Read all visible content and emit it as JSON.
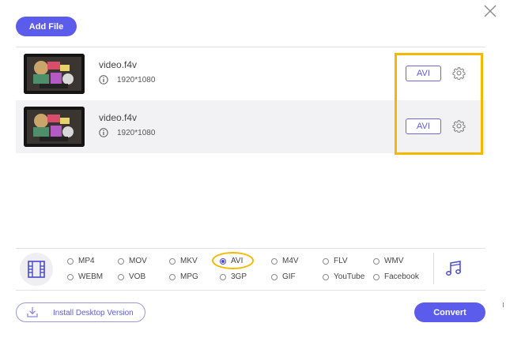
{
  "toolbar": {
    "add_file_label": "Add File"
  },
  "files": [
    {
      "name": "video.f4v",
      "resolution": "1920*1080",
      "format": "AVI"
    },
    {
      "name": "video.f4v",
      "resolution": "1920*1080",
      "format": "AVI"
    }
  ],
  "formats": [
    {
      "label": "MP4",
      "selected": false
    },
    {
      "label": "MOV",
      "selected": false
    },
    {
      "label": "MKV",
      "selected": false
    },
    {
      "label": "AVI",
      "selected": true
    },
    {
      "label": "M4V",
      "selected": false
    },
    {
      "label": "FLV",
      "selected": false
    },
    {
      "label": "WMV",
      "selected": false
    },
    {
      "label": "WEBM",
      "selected": false
    },
    {
      "label": "VOB",
      "selected": false
    },
    {
      "label": "MPG",
      "selected": false
    },
    {
      "label": "3GP",
      "selected": false
    },
    {
      "label": "GIF",
      "selected": false
    },
    {
      "label": "YouTube",
      "selected": false
    },
    {
      "label": "Facebook",
      "selected": false
    }
  ],
  "footer": {
    "install_label": "Install Desktop Version",
    "convert_label": "Convert"
  },
  "colors": {
    "accent": "#5b5ceb",
    "highlight": "#f5b800",
    "selected_row_bg": "#f2f2f4"
  },
  "icons": {
    "close": "close-icon",
    "info": "info-icon",
    "settings": "gear-icon",
    "video_category": "film-icon",
    "audio_category": "music-note-icon",
    "download": "download-icon"
  }
}
